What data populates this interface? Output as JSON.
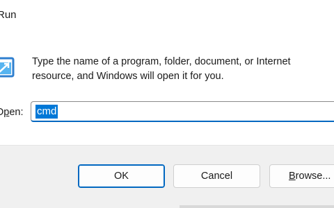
{
  "window": {
    "title": "Run"
  },
  "content": {
    "icon": "run-dialog-icon",
    "description_line1": "Type the name of a program, folder, document, or Internet",
    "description_line2": "resource, and Windows will open it for you.",
    "open_label_prefix": "O",
    "open_label_underlined": "p",
    "open_label_rest": "en:",
    "open_value": "cmd"
  },
  "buttons": {
    "ok": "OK",
    "cancel": "Cancel",
    "browse_underlined": "B",
    "browse_rest": "rowse..."
  },
  "colors": {
    "accent": "#0067c0",
    "selection": "#0078d7",
    "footer_bg": "#f0f0f0"
  }
}
